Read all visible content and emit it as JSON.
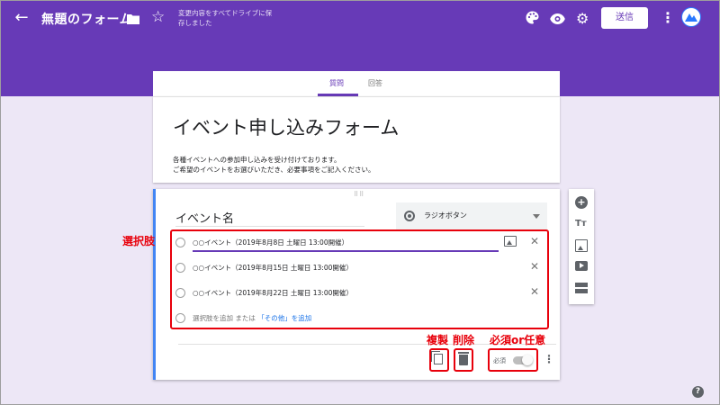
{
  "topbar": {
    "form_title": "無題のフォーム",
    "save_status": "変更内容をすべてドライブに保存しました",
    "send_label": "送信",
    "icons": [
      "back-icon",
      "folder-icon",
      "star-icon",
      "palette-icon",
      "eye-icon",
      "gear-icon",
      "more-icon"
    ],
    "accent_color": "#673ab7"
  },
  "tabs": [
    {
      "label": "質問",
      "active": true
    },
    {
      "label": "回答",
      "active": false
    }
  ],
  "title_card": {
    "title": "イベント申し込みフォーム",
    "description_line1": "各種イベントへの参加申し込みを受け付けております。",
    "description_line2": "ご希望のイベントをお選びいただき、必要事項をご記入ください。"
  },
  "question": {
    "title": "イベント名",
    "type": "ラジオボタン",
    "options": [
      "○○イベント（2019年8月8日 土曜日 13:00開催）",
      "○○イベント（2019年8月15日 土曜日 13:00開催）",
      "○○イベント（2019年8月22日 土曜日 13:00開催）"
    ],
    "add_option": "選択肢を追加",
    "or": " または ",
    "add_other": "「その他」を追加",
    "required_label": "必須",
    "required_on": false
  },
  "annotations": {
    "choices": "選択肢",
    "copy": "複製",
    "delete": "削除",
    "required_or_optional": "必須or任意",
    "color": "#e8000b"
  },
  "side_toolbar": [
    "add-question-icon",
    "add-title-icon",
    "add-image-icon",
    "add-video-icon",
    "add-section-icon"
  ]
}
